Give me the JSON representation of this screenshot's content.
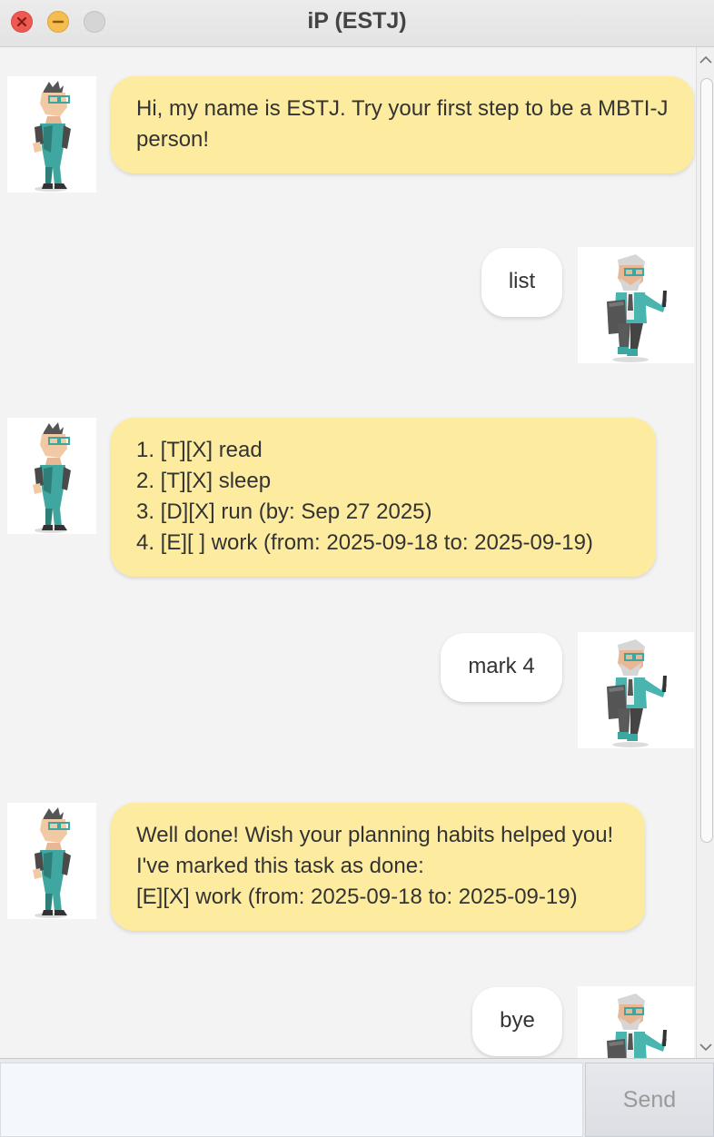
{
  "window": {
    "title": "iP (ESTJ)"
  },
  "messages": [
    {
      "sender": "bot",
      "text": "Hi, my name is ESTJ. Try your first step to be a MBTI-J\nperson!"
    },
    {
      "sender": "user",
      "text": "list"
    },
    {
      "sender": "bot",
      "text": "1. [T][X] read\n2. [T][X] sleep\n3. [D][X] run (by: Sep 27 2025)\n4. [E][ ] work (from: 2025-09-18 to: 2025-09-19)"
    },
    {
      "sender": "user",
      "text": "mark 4"
    },
    {
      "sender": "bot",
      "text": "Well done! Wish your planning habits helped you!\nI've marked this task as done:\n[E][X] work (from: 2025-09-18 to: 2025-09-19)"
    },
    {
      "sender": "user",
      "text": "bye"
    }
  ],
  "input": {
    "value": "",
    "send_label": "Send"
  },
  "colors": {
    "bot_bubble": "#fdec9f",
    "user_bubble": "#ffffff",
    "background": "#f3f3f3"
  }
}
